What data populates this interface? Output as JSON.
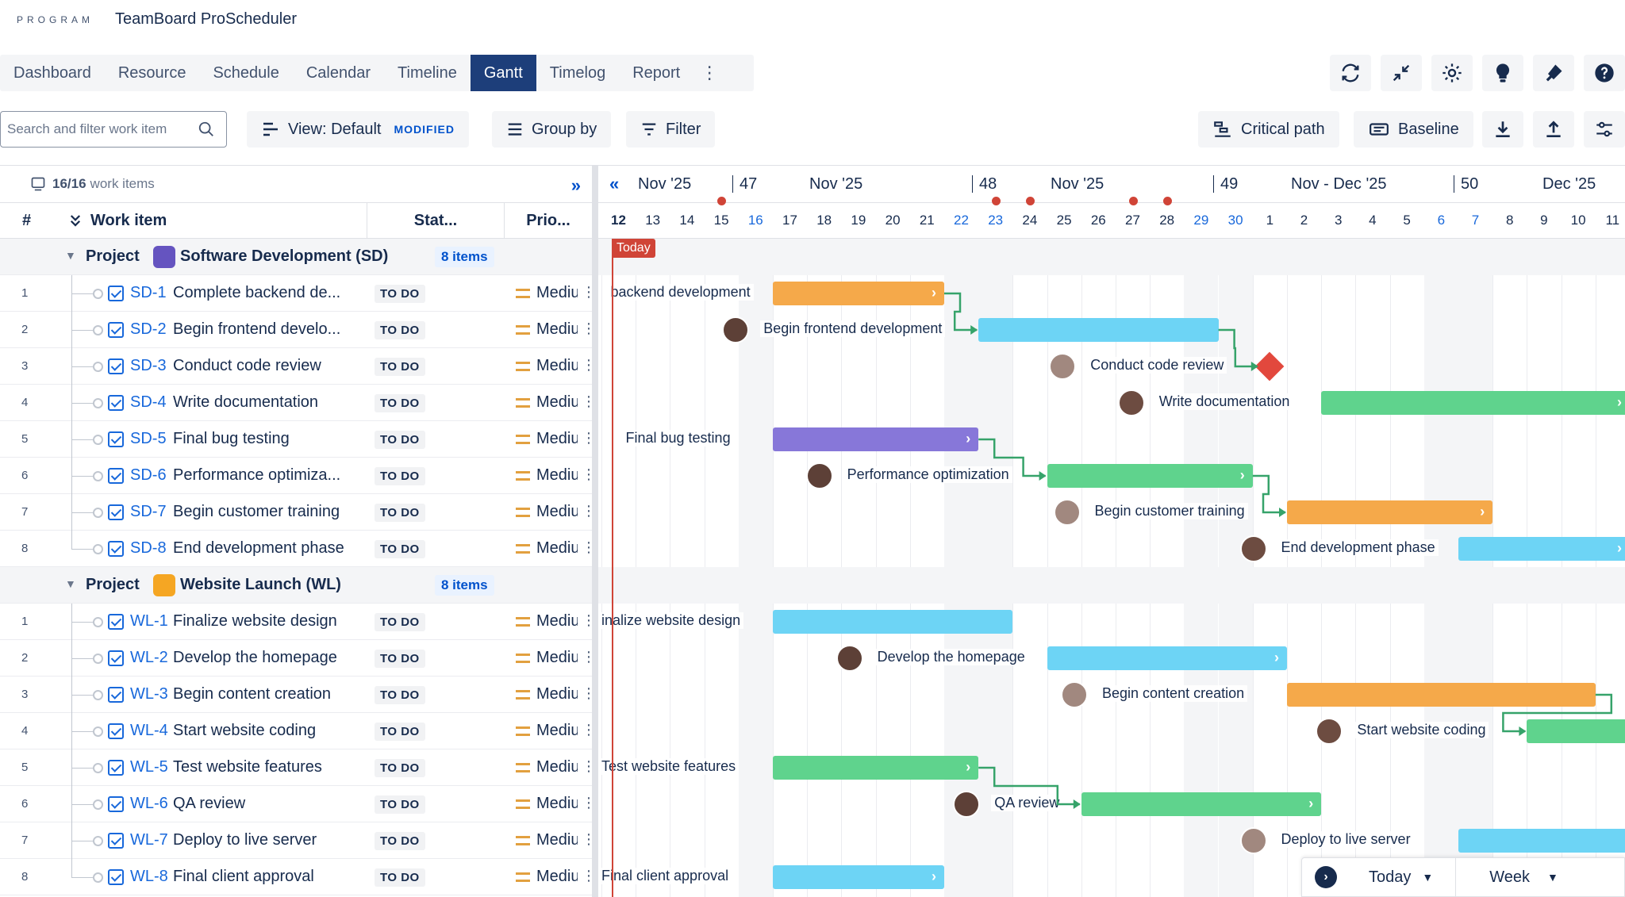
{
  "header": {
    "brand": "PROGRAM",
    "title": "TeamBoard ProScheduler"
  },
  "tabs": [
    "Dashboard",
    "Resource",
    "Schedule",
    "Calendar",
    "Timeline",
    "Gantt",
    "Timelog",
    "Report"
  ],
  "active_tab": "Gantt",
  "toolbar": {
    "search_placeholder": "Search and filter work item",
    "view_label": "View: Default",
    "view_badge": "MODIFIED",
    "group_by": "Group by",
    "filter": "Filter",
    "critical_path": "Critical path",
    "baseline": "Baseline"
  },
  "grid": {
    "summary_count": "16/16",
    "summary_label": "work items",
    "col_num": "#",
    "col_item": "Work item",
    "col_status": "Stat...",
    "col_priority": "Prio..."
  },
  "groups": [
    {
      "label": "Project",
      "name": "Software Development (SD)",
      "count": "8 items",
      "avatar_color": "#6554c0",
      "items": [
        {
          "num": "1",
          "key": "SD-1",
          "title": "Complete backend de...",
          "status": "TO DO",
          "priority": "Medium"
        },
        {
          "num": "2",
          "key": "SD-2",
          "title": "Begin frontend develo...",
          "status": "TO DO",
          "priority": "Medium"
        },
        {
          "num": "3",
          "key": "SD-3",
          "title": "Conduct code review",
          "status": "TO DO",
          "priority": "Medium"
        },
        {
          "num": "4",
          "key": "SD-4",
          "title": "Write documentation",
          "status": "TO DO",
          "priority": "Medium"
        },
        {
          "num": "5",
          "key": "SD-5",
          "title": "Final bug testing",
          "status": "TO DO",
          "priority": "Medium"
        },
        {
          "num": "6",
          "key": "SD-6",
          "title": "Performance optimiza...",
          "status": "TO DO",
          "priority": "Medium"
        },
        {
          "num": "7",
          "key": "SD-7",
          "title": "Begin customer training",
          "status": "TO DO",
          "priority": "Medium"
        },
        {
          "num": "8",
          "key": "SD-8",
          "title": "End development phase",
          "status": "TO DO",
          "priority": "Medium"
        }
      ]
    },
    {
      "label": "Project",
      "name": "Website Launch (WL)",
      "count": "8 items",
      "avatar_color": "#f5a623",
      "items": [
        {
          "num": "1",
          "key": "WL-1",
          "title": "Finalize website design",
          "status": "TO DO",
          "priority": "Medium"
        },
        {
          "num": "2",
          "key": "WL-2",
          "title": "Develop the homepage",
          "status": "TO DO",
          "priority": "Medium"
        },
        {
          "num": "3",
          "key": "WL-3",
          "title": "Begin content creation",
          "status": "TO DO",
          "priority": "Medium"
        },
        {
          "num": "4",
          "key": "WL-4",
          "title": "Start website coding",
          "status": "TO DO",
          "priority": "Medium"
        },
        {
          "num": "5",
          "key": "WL-5",
          "title": "Test website features",
          "status": "TO DO",
          "priority": "Medium"
        },
        {
          "num": "6",
          "key": "WL-6",
          "title": "QA review",
          "status": "TO DO",
          "priority": "Medium"
        },
        {
          "num": "7",
          "key": "WL-7",
          "title": "Deploy to live server",
          "status": "TO DO",
          "priority": "Medium"
        },
        {
          "num": "8",
          "key": "WL-8",
          "title": "Final client approval",
          "status": "TO DO",
          "priority": "Medium"
        }
      ]
    }
  ],
  "timeline": {
    "months": [
      {
        "label": "Nov '25",
        "week": "47"
      },
      {
        "label": "Nov '25",
        "week": "48"
      },
      {
        "label": "Nov '25",
        "week": "49"
      },
      {
        "label": "Nov - Dec '25",
        "week": "50"
      },
      {
        "label": "Dec '25",
        "week": ""
      }
    ],
    "days": [
      "12",
      "13",
      "14",
      "15",
      "16",
      "17",
      "18",
      "19",
      "20",
      "21",
      "22",
      "23",
      "24",
      "25",
      "26",
      "27",
      "28",
      "29",
      "30",
      "1",
      "2",
      "3",
      "4",
      "5",
      "6",
      "7",
      "8",
      "9",
      "10",
      "11"
    ],
    "weekend_days": [
      "16",
      "22",
      "23",
      "29",
      "30",
      "6",
      "7"
    ],
    "holiday_days": [
      "15",
      "23",
      "24",
      "27",
      "28"
    ],
    "today_label": "Today",
    "tasks": [
      {
        "label": "backend development",
        "start": 5,
        "end": 9,
        "color": "#f5a94a",
        "chev": true
      },
      {
        "label": "Begin frontend development",
        "start": 11,
        "end": 17,
        "color": "#6dd4f5",
        "chev": false
      },
      {
        "label": "Conduct code review",
        "start": 19,
        "end": 19,
        "color": "#e2483d",
        "milestone": true
      },
      {
        "label": "Write documentation",
        "start": 21,
        "end": 29,
        "color": "#5fd38d",
        "chev": true
      },
      {
        "label": "Final bug testing",
        "start": 5,
        "end": 10,
        "color": "#8777d9",
        "chev": true
      },
      {
        "label": "Performance optimization",
        "start": 13,
        "end": 18,
        "color": "#5fd38d",
        "chev": true
      },
      {
        "label": "Begin customer training",
        "start": 20,
        "end": 25,
        "color": "#f5a94a",
        "chev": true
      },
      {
        "label": "End development phase",
        "start": 25,
        "end": 29,
        "color": "#6dd4f5",
        "chev": true
      },
      {
        "label": "inalize website design",
        "start": 5,
        "end": 11,
        "color": "#6dd4f5",
        "chev": false
      },
      {
        "label": "Develop the homepage",
        "start": 13,
        "end": 19,
        "color": "#6dd4f5",
        "chev": true
      },
      {
        "label": "Begin content creation",
        "start": 20,
        "end": 28,
        "color": "#f5a94a",
        "chev": false
      },
      {
        "label": "Start website coding",
        "start": 27,
        "end": 30,
        "color": "#5fd38d",
        "chev": false
      },
      {
        "label": "Test website features",
        "start": 5,
        "end": 10,
        "color": "#5fd38d",
        "chev": true
      },
      {
        "label": "QA review",
        "start": 14,
        "end": 20,
        "color": "#5fd38d",
        "chev": true
      },
      {
        "label": "Deploy to live server",
        "start": 25,
        "end": 30,
        "color": "#6dd4f5",
        "chev": false
      },
      {
        "label": "Final client approval",
        "start": 5,
        "end": 9,
        "color": "#6dd4f5",
        "chev": true
      }
    ]
  },
  "bottom": {
    "today": "Today",
    "scale": "Week"
  }
}
